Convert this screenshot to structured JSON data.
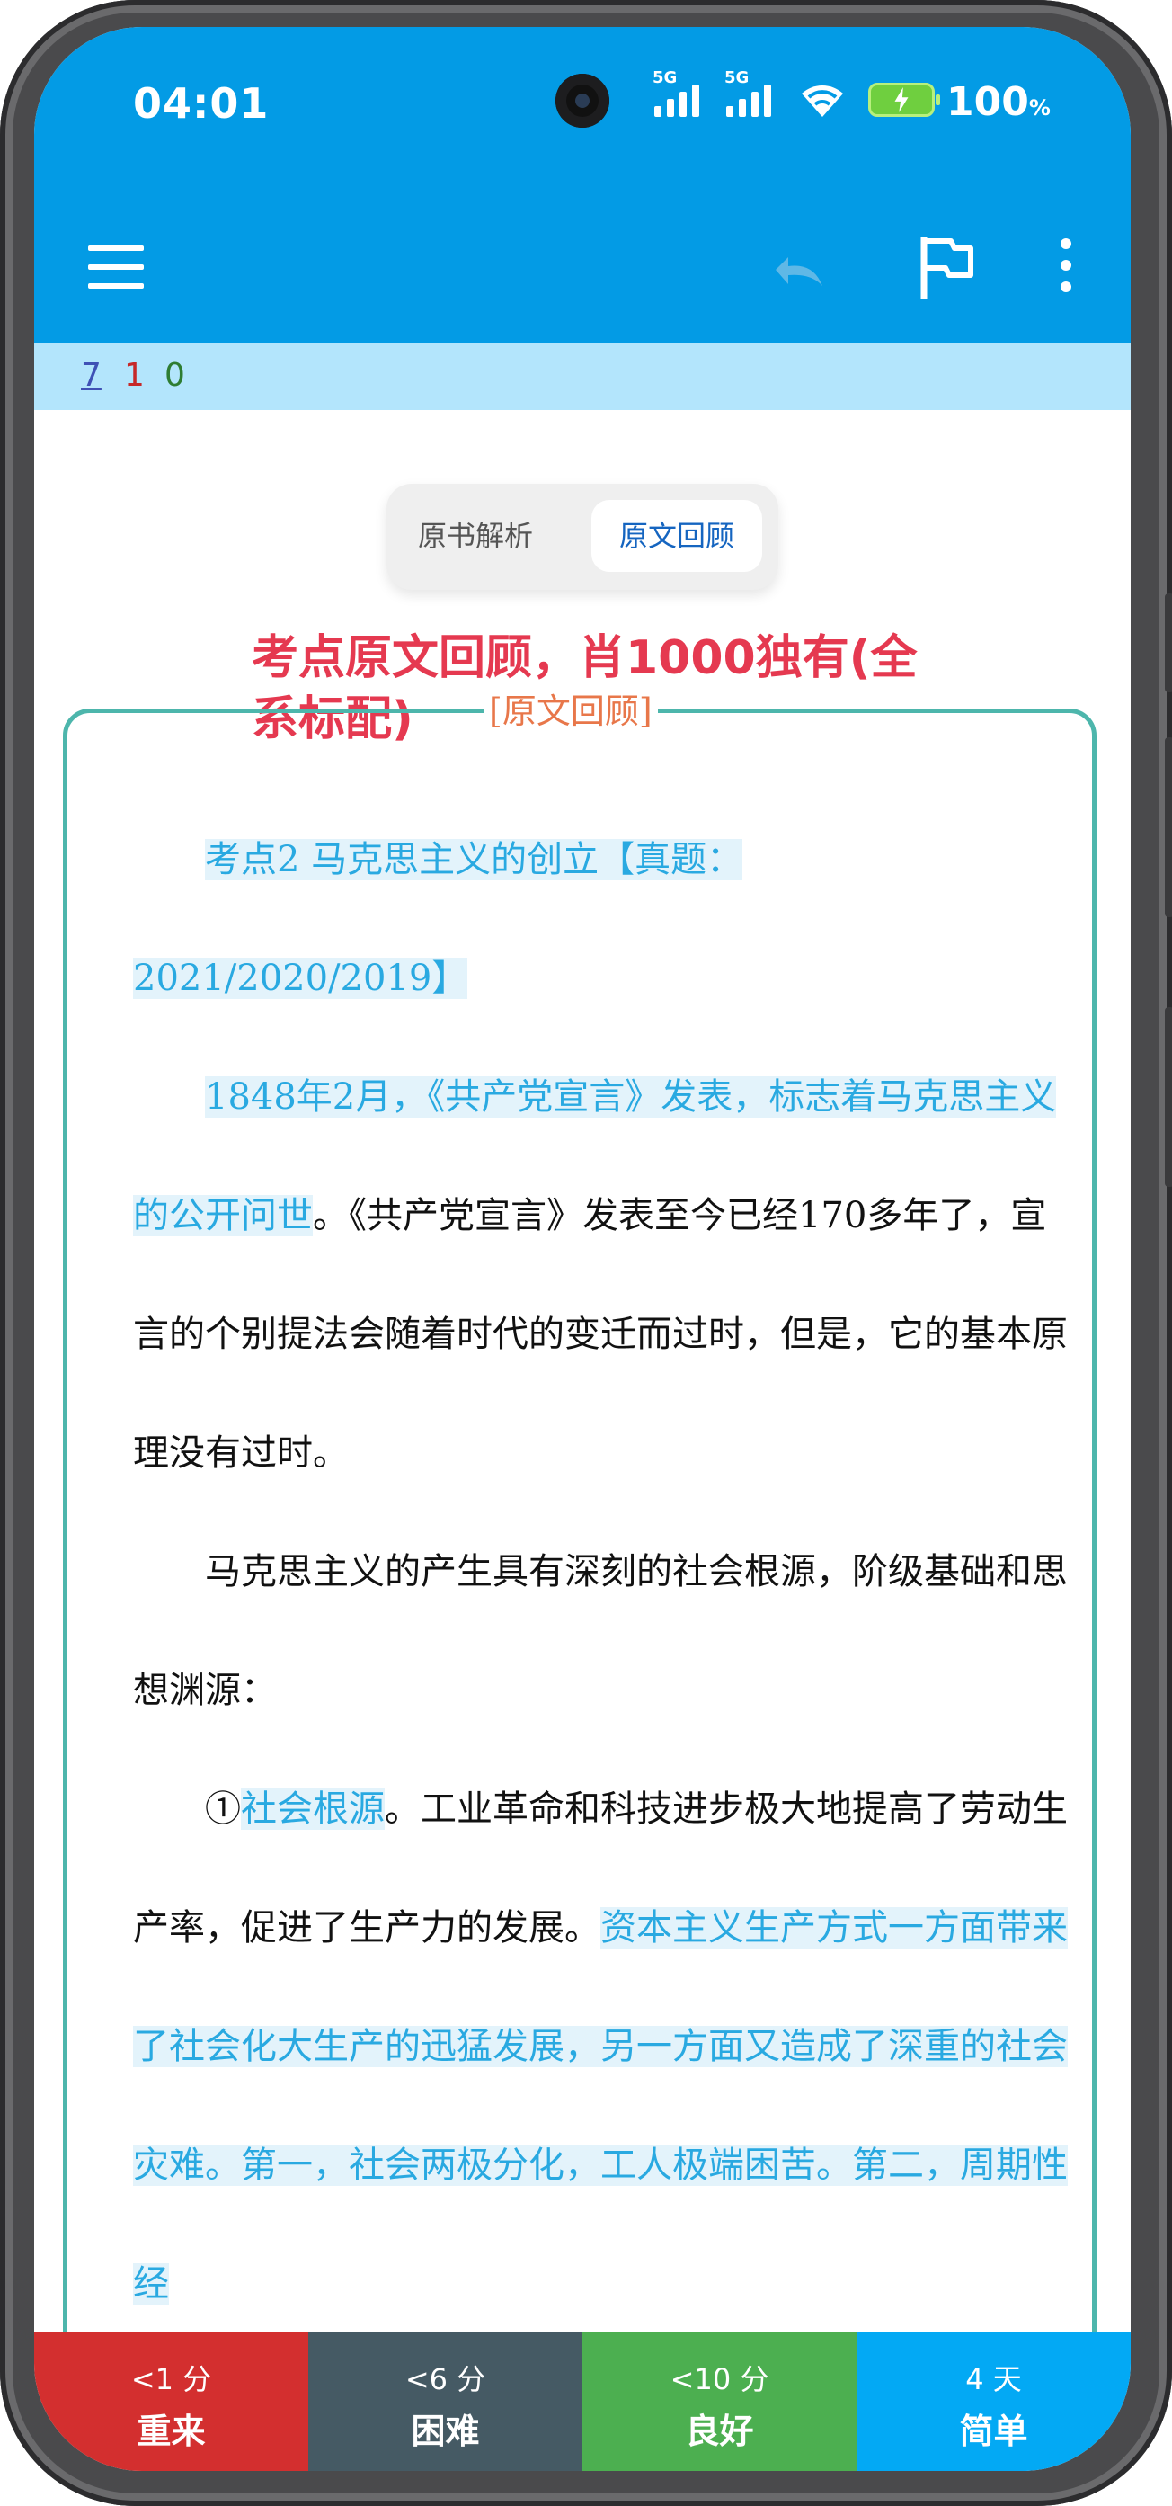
{
  "status_bar": {
    "time": "04:01",
    "signal_1_label": "5G",
    "signal_2_label": "5G",
    "battery_percent": "100",
    "battery_unit": "%"
  },
  "toolbar": {
    "menu_icon": "hamburger-menu-icon",
    "undo_icon": "undo-icon",
    "flag_icon": "flag-icon",
    "more_icon": "more-vert-icon",
    "color": "#039be5"
  },
  "counts": {
    "new": "7",
    "learning": "1",
    "review": "0"
  },
  "segmented_tabs": {
    "tab_1": "原书解析",
    "tab_2": "原文回顾",
    "selected": "原文回顾"
  },
  "card": {
    "heading_line1": "考点原文回顾，肖1000独有(全",
    "heading_line2": "系标配)",
    "box_legend": "[原文回顾]",
    "p1": "考点2 马克思主义的创立【真题：",
    "p1b": "2021/2020/2019】",
    "p2_hl": "1848年2月，《共产党宣言》发表，标志着马克思主义的公开问世",
    "p2_rest": "。《共产党宣言》发表至今已经170多年了，宣言的个别提法会随着时代的变迁而过时，但是，它的基本原理没有过时。",
    "p3": "马克思主义的产生具有深刻的社会根源，阶级基础和思想渊源：",
    "p4_num": "①",
    "p4_hl1": "社会根源",
    "p4_mid": "。工业革命和科技进步极大地提高了劳动生产率，促进了生产力的发展。",
    "p4_hl2": "资本主义生产方式一方面带来了社会化大生产的迅猛发展，另一方面又造成了深重的社会灾难。第一，社会两极分化，工人极端困苦。第二，周期性经"
  },
  "answer_buttons": [
    {
      "interval": "<1 分",
      "label": "重来",
      "color": "#d32f2f"
    },
    {
      "interval": "<6 分",
      "label": "困难",
      "color": "#455a64"
    },
    {
      "interval": "<10 分",
      "label": "良好",
      "color": "#4caf50"
    },
    {
      "interval": "4 天",
      "label": "简单",
      "color": "#03a9f4"
    }
  ]
}
